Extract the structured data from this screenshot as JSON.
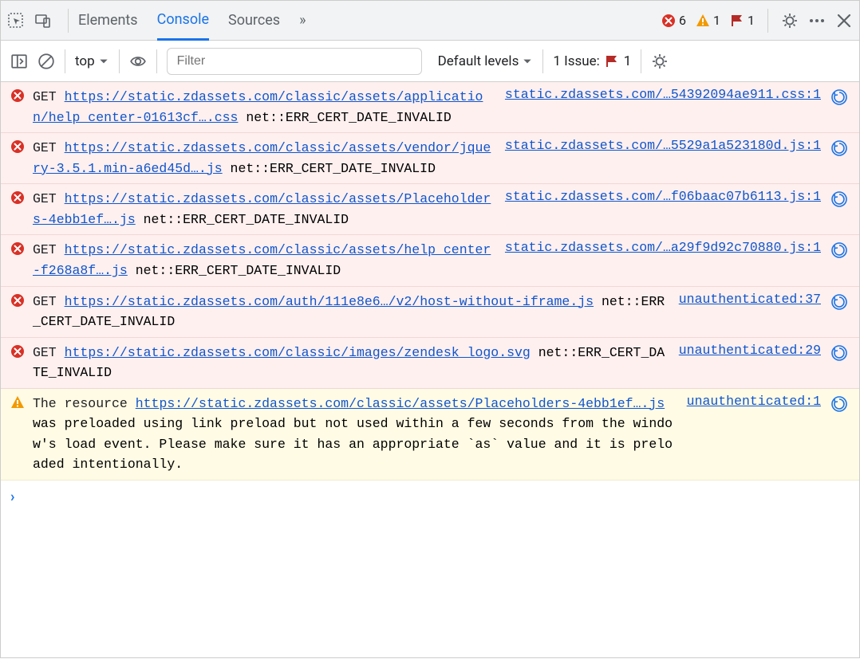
{
  "tabbar": {
    "tabs": [
      "Elements",
      "Console",
      "Sources"
    ],
    "active_index": 1,
    "more_label": "»",
    "error_count": "6",
    "warning_count": "1",
    "flag_count": "1"
  },
  "subbar": {
    "context": "top",
    "filter_placeholder": "Filter",
    "levels": "Default levels",
    "issues_label": "1 Issue:",
    "issues_flag_count": "1"
  },
  "messages": [
    {
      "type": "error",
      "prefix": "GET",
      "url": "https://static.zdassets.com/classic/assets/application/help_center-01613cf….css",
      "suffix": " net::ERR_CERT_DATE_INVALID",
      "source": "static.zdassets.com/…54392094ae911.css:1"
    },
    {
      "type": "error",
      "prefix": "GET",
      "url": "https://static.zdassets.com/classic/assets/vendor/jquery-3.5.1.min-a6ed45d….js",
      "suffix": " net::ERR_CERT_DATE_INVALID",
      "source": "static.zdassets.com/…5529a1a523180d.js:1"
    },
    {
      "type": "error",
      "prefix": "GET",
      "url": "https://static.zdassets.com/classic/assets/Placeholders-4ebb1ef….js",
      "suffix": " net::ERR_CERT_DATE_INVALID",
      "source": "static.zdassets.com/…f06baac07b6113.js:1"
    },
    {
      "type": "error",
      "prefix": "GET",
      "url": "https://static.zdassets.com/classic/assets/help_center-f268a8f….js",
      "suffix": " net::ERR_CERT_DATE_INVALID",
      "source": "static.zdassets.com/…a29f9d92c70880.js:1"
    },
    {
      "type": "error",
      "prefix": "GET",
      "url": "https://static.zdassets.com/auth/111e8e6…/v2/host-without-iframe.js",
      "suffix": " net::ERR_CERT_DATE_INVALID",
      "source": "unauthenticated:37"
    },
    {
      "type": "error",
      "prefix": "GET",
      "url": "https://static.zdassets.com/classic/images/zendesk_logo.svg",
      "suffix": " net::ERR_CERT_DATE_INVALID",
      "source": "unauthenticated:29"
    },
    {
      "type": "warn",
      "prefix": "The resource ",
      "url": "https://static.zdassets.com/classic/assets/Placeholders-4ebb1ef….js",
      "suffix": " was preloaded using link preload but not used within a few seconds from the window's load event. Please make sure it has an appropriate `as` value and it is preloaded intentionally.",
      "source": "unauthenticated:1"
    }
  ],
  "prompt": "›"
}
